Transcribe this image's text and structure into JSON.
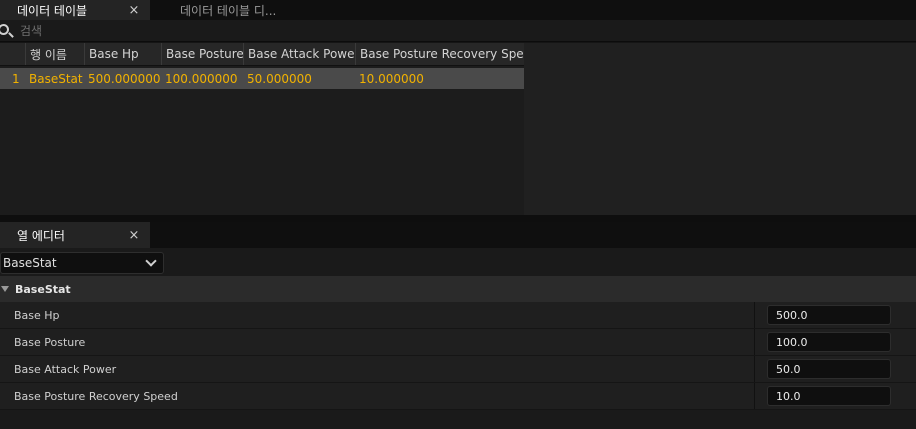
{
  "tabs": {
    "active": {
      "label": "데이터 테이블",
      "close": "×"
    },
    "inactive": {
      "label": "데이터 테이블 디..."
    }
  },
  "search": {
    "placeholder": "검색"
  },
  "table": {
    "columns": [
      "",
      "행 이름",
      "Base Hp",
      "Base Posture",
      "Base Attack Power",
      "Base Posture Recovery Speed"
    ],
    "rows": [
      [
        "1",
        "BaseStat",
        "500.000000",
        "100.000000",
        "50.000000",
        "10.000000"
      ]
    ]
  },
  "column_editor": {
    "tab_label": "열 에디터",
    "close": "×",
    "row_select": "BaseStat",
    "category": "BaseStat",
    "properties": [
      {
        "label": "Base Hp",
        "value": "500.0"
      },
      {
        "label": "Base Posture",
        "value": "100.0"
      },
      {
        "label": "Base Attack Power",
        "value": "50.0"
      },
      {
        "label": "Base Posture Recovery Speed",
        "value": "10.0"
      }
    ]
  },
  "colors": {
    "highlight_text": "#f2b200",
    "selected_row": "#4a4a4a"
  }
}
